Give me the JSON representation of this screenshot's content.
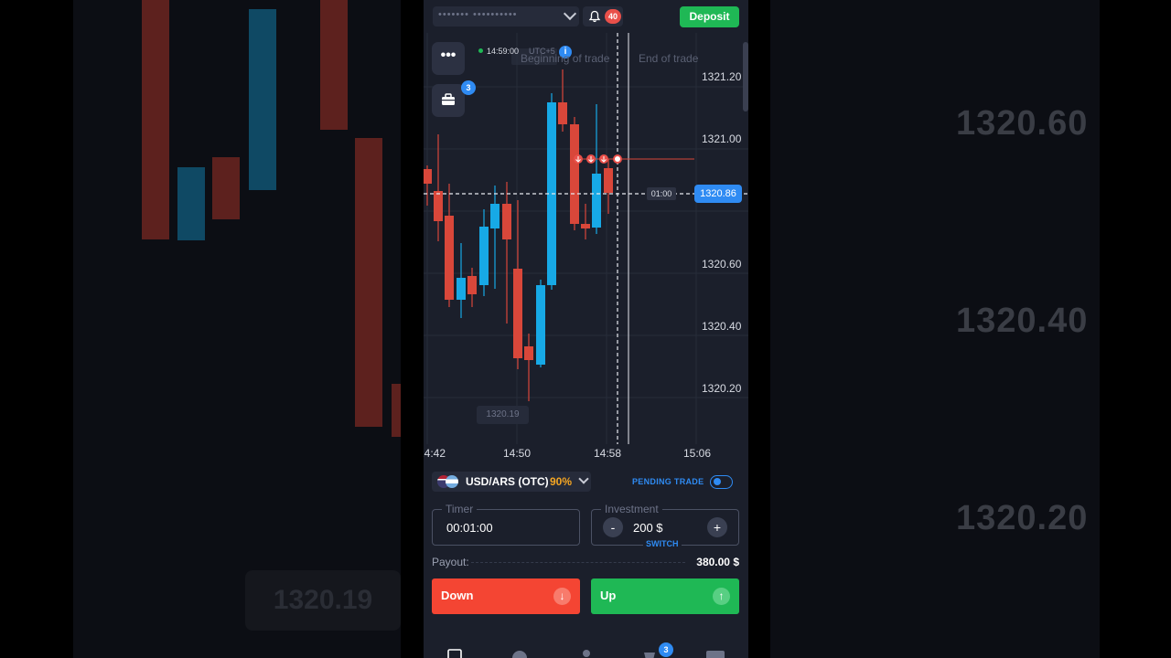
{
  "background": {
    "prices": [
      "1320.60",
      "1320.40",
      "1320.20"
    ],
    "badge": "1320.19"
  },
  "topbar": {
    "account_masked": "••••••• ••••••••••",
    "notifications_count": "40",
    "deposit_label": "Deposit"
  },
  "chart": {
    "clock": "14:59:00",
    "timezone": "UTC+5",
    "beginning_label": "Beginning of trade",
    "end_label": "End of trade",
    "portfolio_count": "3",
    "y_ticks": [
      "1321.20",
      "1321.00",
      "1320.60",
      "1320.40",
      "1320.20"
    ],
    "x_ticks": [
      "14:42",
      "14:50",
      "14:58",
      "15:06"
    ],
    "current_price": "1320.86",
    "countdown": "01:00",
    "low_label": "1320.19",
    "colors": {
      "up": "#17a9e6",
      "down": "#d9473a",
      "background": "#1b1f2b"
    }
  },
  "chart_data": {
    "type": "candlestick",
    "x": [
      "14:42",
      "14:50",
      "14:58",
      "15:06"
    ],
    "ylim": [
      1320.1,
      1321.3
    ],
    "grid": true,
    "current_price": 1320.86
  },
  "trade": {
    "pair": "USD/ARS (OTC)",
    "payout_pct": "90%",
    "pending_label": "PENDING TRADE",
    "timer_label": "Timer",
    "timer_value": "00:01:00",
    "investment_label": "Investment",
    "investment_value": "200 $",
    "switch_label": "SWITCH",
    "payout_label": "Payout:",
    "payout_value": "380.00 $",
    "down_label": "Down",
    "up_label": "Up"
  },
  "bottom_nav": {
    "achievements_count": "3"
  }
}
